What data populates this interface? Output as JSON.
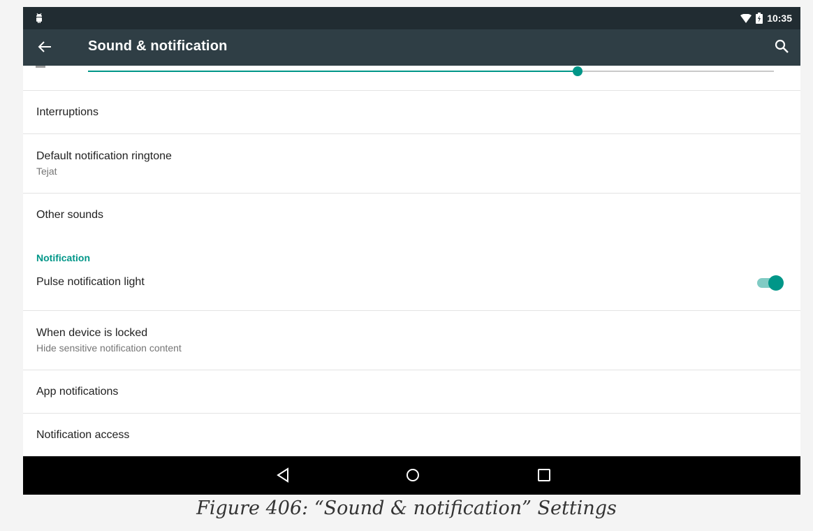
{
  "status_bar": {
    "time": "10:35",
    "icons": [
      "android-icon",
      "wifi-icon",
      "battery-icon"
    ]
  },
  "app_bar": {
    "title": "Sound & notification",
    "back_icon": "arrow-back-icon",
    "search_icon": "search-icon"
  },
  "volume_slider": {
    "level": 0.714
  },
  "items": {
    "interruptions": {
      "title": "Interruptions"
    },
    "ringtone": {
      "title": "Default notification ringtone",
      "summary": "Tejat"
    },
    "other_sounds": {
      "title": "Other sounds"
    },
    "notification_header": "Notification",
    "pulse": {
      "title": "Pulse notification light",
      "checked": true
    },
    "locked": {
      "title": "When device is locked",
      "summary": "Hide sensitive notification content"
    },
    "app_notifications": {
      "title": "App notifications"
    },
    "notification_access": {
      "title": "Notification access"
    }
  },
  "nav_bar": {
    "icons": [
      "back-triangle-icon",
      "home-circle-icon",
      "recents-square-icon"
    ]
  },
  "caption": "Figure 406: “Sound & notification” Settings",
  "colors": {
    "accent": "#009688",
    "status_bar": "#212c32",
    "app_bar": "#2f3e45",
    "nav_bar": "#000000"
  }
}
